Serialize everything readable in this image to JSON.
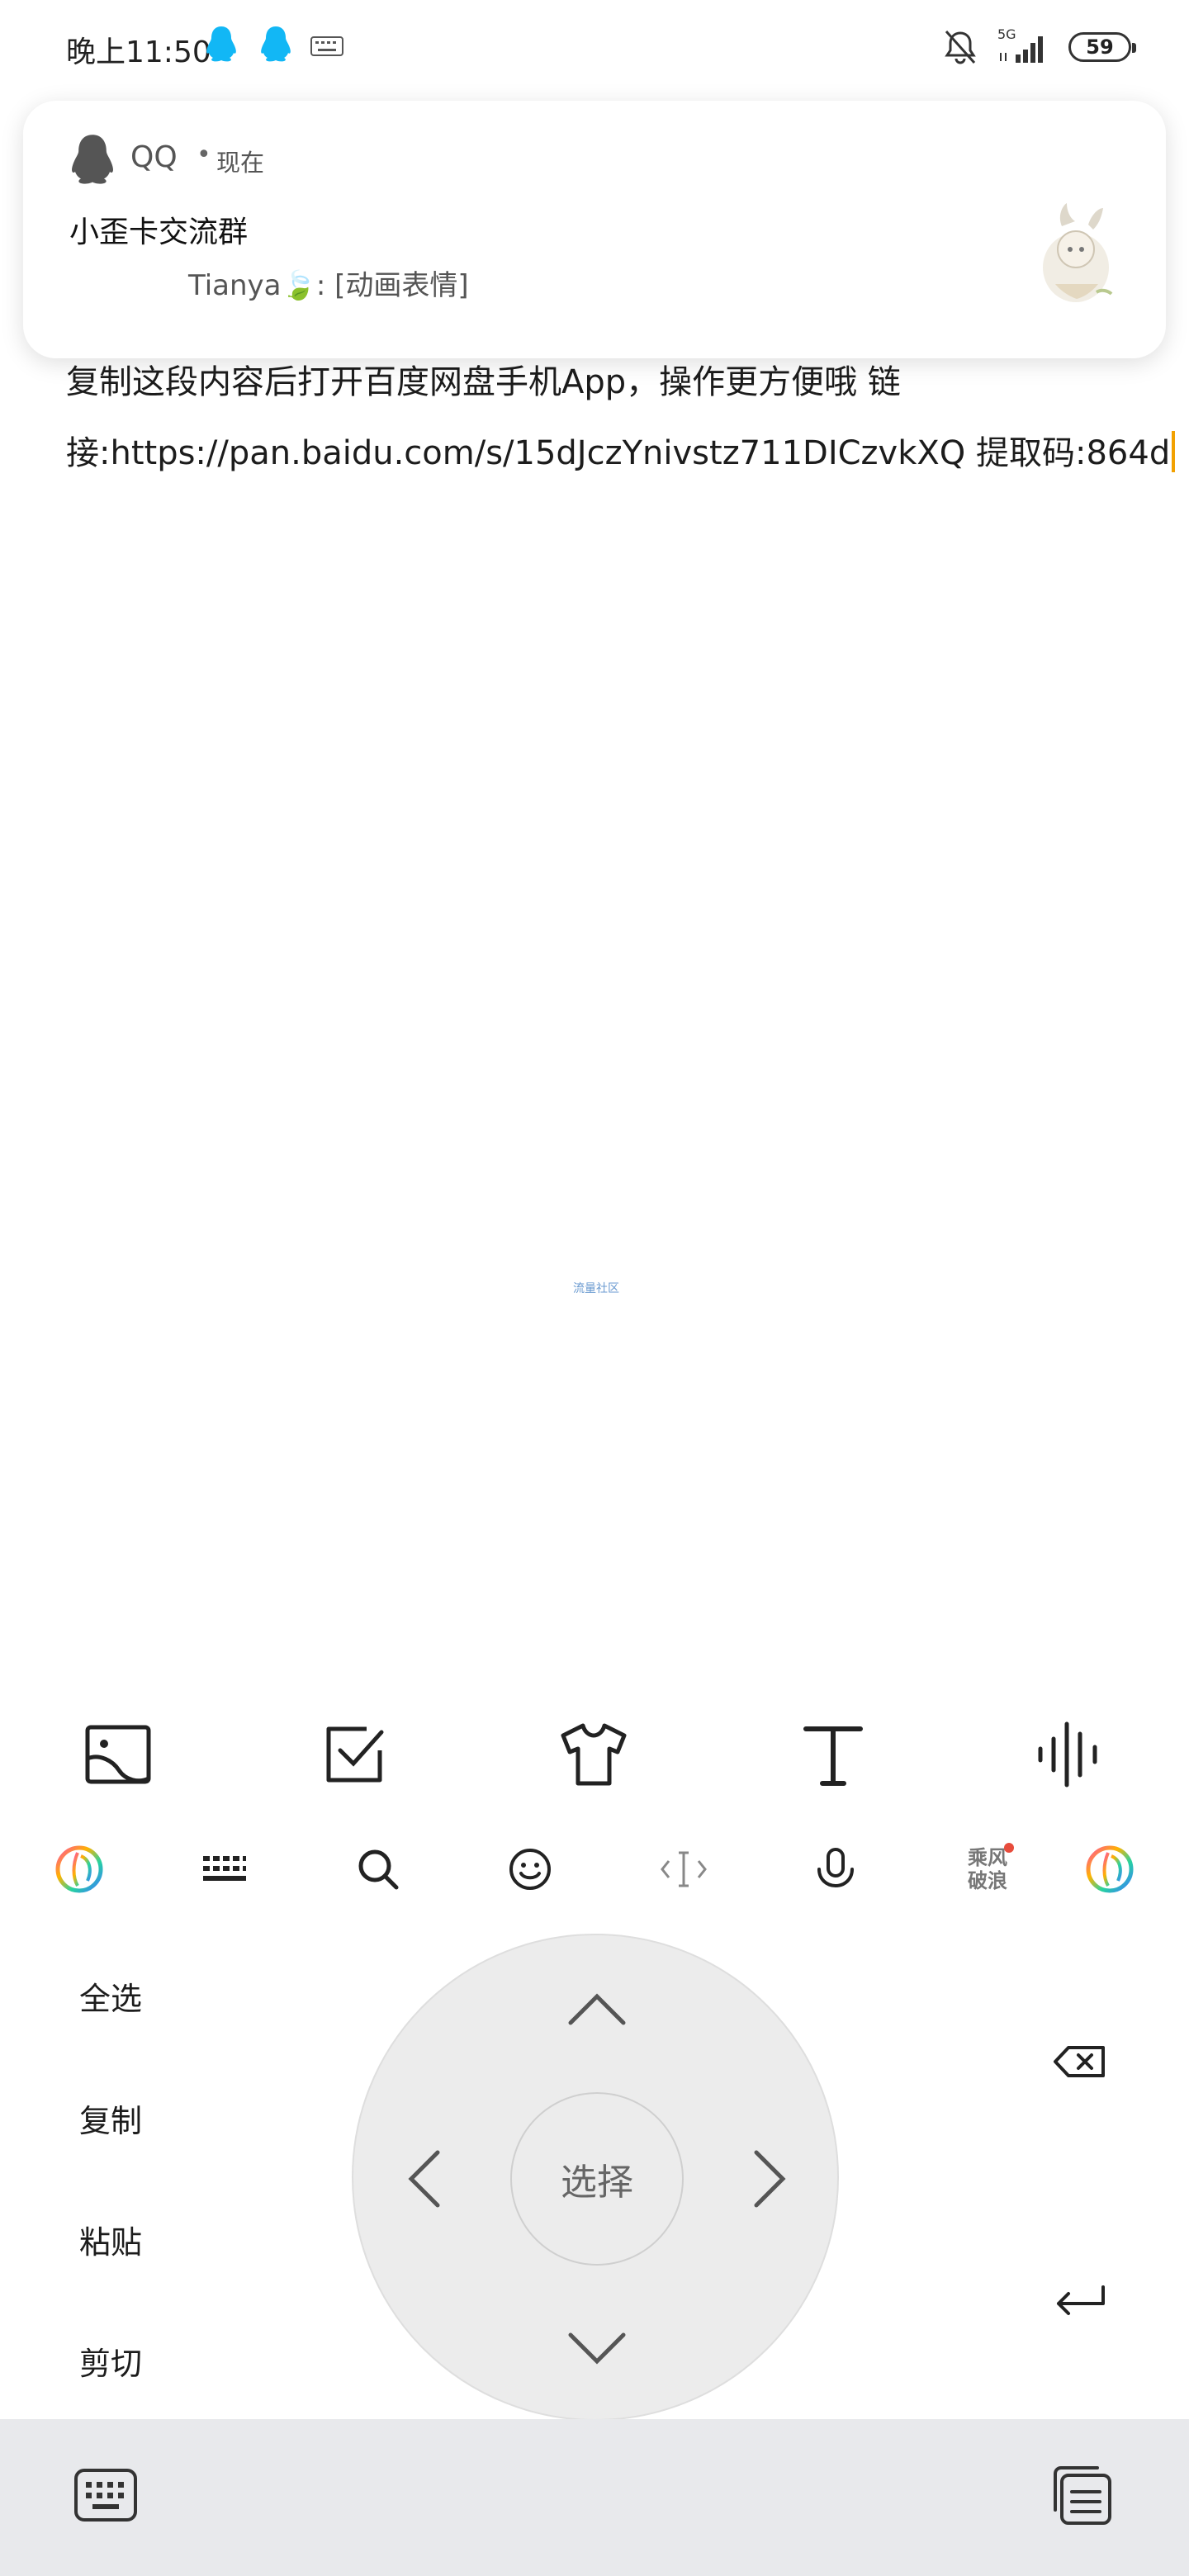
{
  "status_bar": {
    "time": "晚上11:50",
    "network": "5G",
    "battery": "59"
  },
  "notification": {
    "app_name": "QQ",
    "separator": "•",
    "time": "现在",
    "title": "小歪卡交流群",
    "message": "Tianya🍃: [动画表情]"
  },
  "editor": {
    "line1": "复制这段内容后打开百度网盘手机App，操作更方便哦 链",
    "line2": "接:https://pan.baidu.com/s/15dJczYnivstz711DICzvkXQ 提取码:864d",
    "watermark": "流量社区"
  },
  "format_toolbar": {
    "icons": [
      "image-icon",
      "checkbox-icon",
      "shirt-icon",
      "text-icon",
      "audio-icon"
    ]
  },
  "ime_toolbar": {
    "icons": [
      "ime-logo-icon",
      "keyboard-grid-icon",
      "search-icon",
      "emoji-icon",
      "cursor-icon",
      "mic-icon",
      "game-logo-icon",
      "ime-logo-icon"
    ],
    "game_label": "乘风破浪"
  },
  "edit_panel": {
    "select_all": "全选",
    "copy": "复制",
    "paste": "粘贴",
    "cut": "剪切",
    "center_label": "选择"
  },
  "bottom_bar": {
    "icons": [
      "keyboard-icon",
      "clipboard-icon"
    ]
  },
  "colors": {
    "qq_blue": "#12b7f5",
    "caret": "#f2a100",
    "bottom_bar_bg": "#e8e9ec",
    "dpad_bg": "#ececec"
  }
}
